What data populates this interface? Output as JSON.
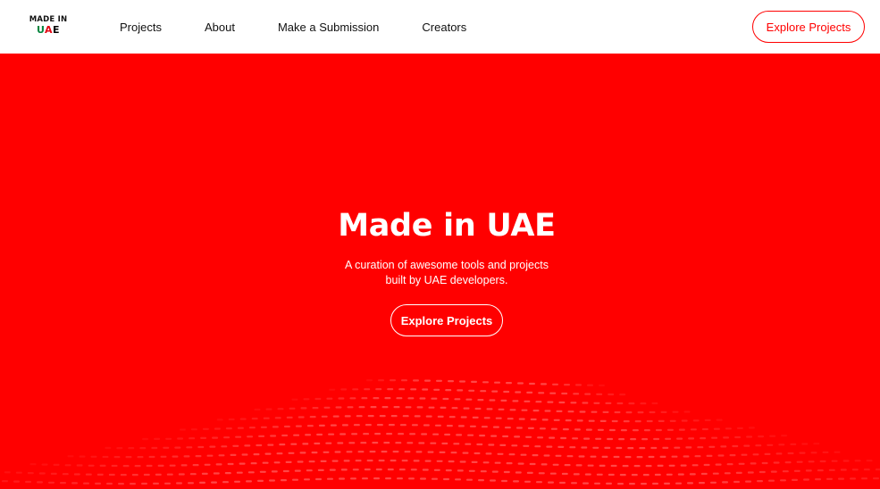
{
  "logo": {
    "line1": "MADE IN",
    "line2_u": "U",
    "line2_a": "A",
    "line2_e": "E"
  },
  "nav": {
    "links": [
      "Projects",
      "About",
      "Make a Submission",
      "Creators"
    ],
    "cta_label": "Explore Projects"
  },
  "hero": {
    "title": "Made in UAE",
    "subtitle_line1": "A curation of awesome tools and projects",
    "subtitle_line2": "built by UAE developers.",
    "cta_label": "Explore Projects"
  },
  "colors": {
    "brand": "#ff0000",
    "nav_bg": "#ffffff",
    "text_dark": "#111111",
    "uae_green": "#00843d",
    "uae_red": "#e30613",
    "uae_black": "#000000"
  }
}
